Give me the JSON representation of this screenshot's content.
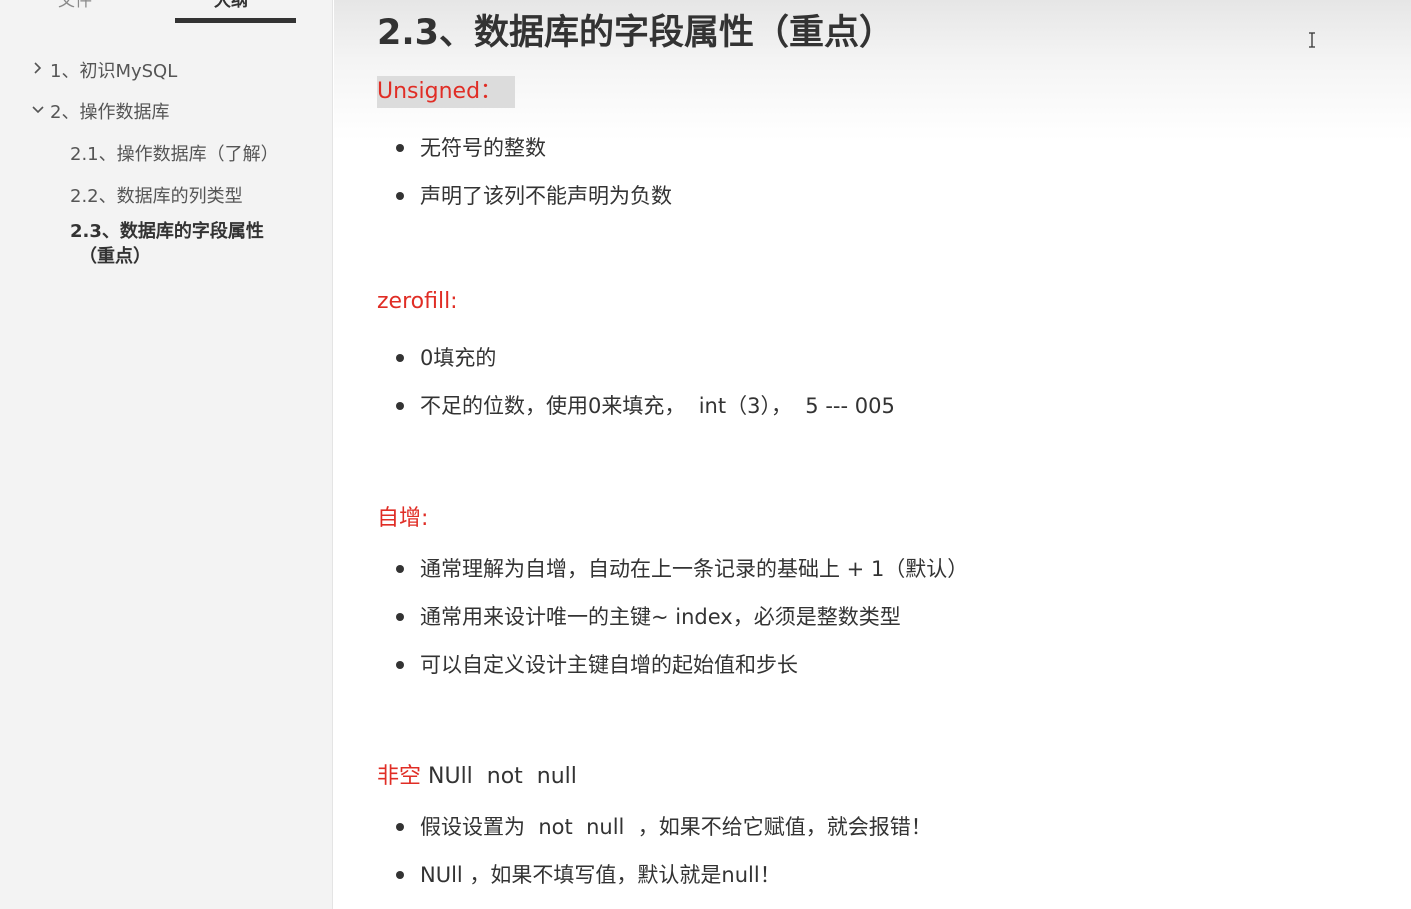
{
  "sidebar": {
    "tabs": {
      "files": "文件",
      "outline": "大纲"
    },
    "items": [
      {
        "label": "1、初识MySQL",
        "icon": "chevron-right-icon"
      },
      {
        "label": "2、操作数据库",
        "icon": "chevron-down-icon"
      },
      {
        "label": "2.1、操作数据库（了解）"
      },
      {
        "label": "2.2、数据库的列类型"
      },
      {
        "label_line1": "2.3、数据库的字段属性",
        "label_line2": "（重点）"
      }
    ]
  },
  "content": {
    "title": "2.3、数据库的字段属性（重点）",
    "sections": [
      {
        "heading": "Unsigned：",
        "bullets": [
          "无符号的整数",
          "声明了该列不能声明为负数"
        ]
      },
      {
        "heading": "zerofill:",
        "bullets": [
          "0填充的",
          "不足的位数，使用0来填充，  int（3），  5 --- 005"
        ]
      },
      {
        "heading": "自增:",
        "bullets": [
          "通常理解为自增，自动在上一条记录的基础上 + 1（默认）",
          "通常用来设计唯一的主键~ index，必须是整数类型",
          "可以自定义设计主键自增的起始值和步长"
        ]
      },
      {
        "heading": "非空",
        "heading_suffix": " NUll  not  null",
        "bullets": [
          "假设设置为  not  null  ，如果不给它赋值，就会报错！",
          "NUll ，如果不填写值，默认就是null！"
        ]
      }
    ]
  },
  "colors": {
    "accent_red": "#e02d25",
    "sidebar_bg": "#f3f3f3",
    "text": "#333333"
  }
}
